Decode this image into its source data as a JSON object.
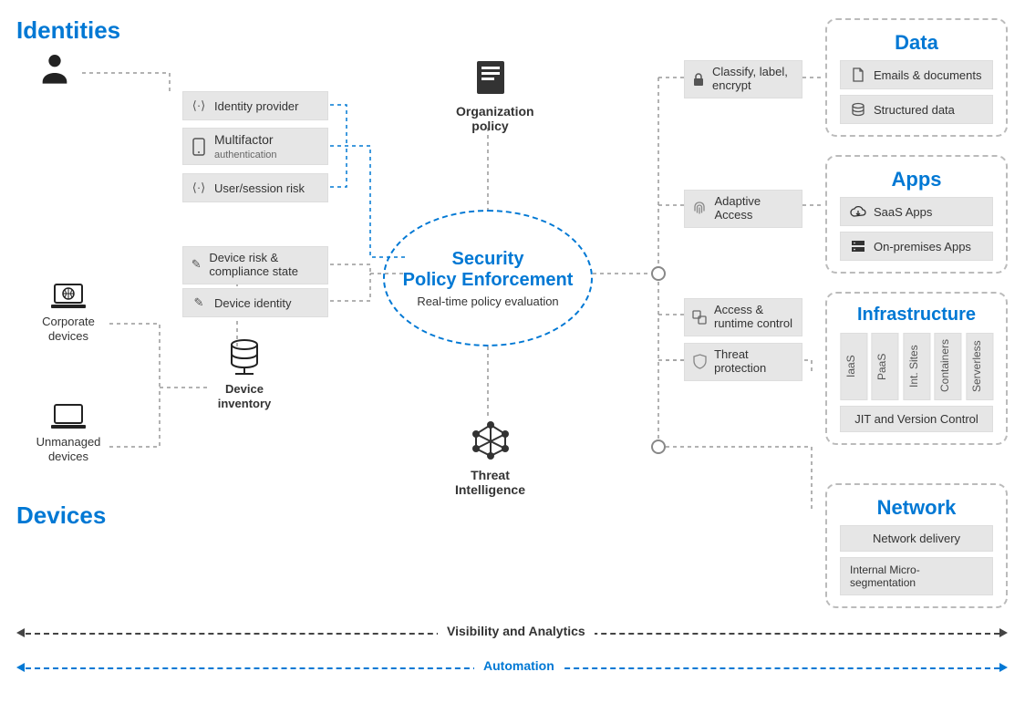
{
  "headings": {
    "identities": "Identities",
    "devices": "Devices"
  },
  "identity_pills": {
    "provider": "Identity  provider",
    "mfa_title": "Multifactor",
    "mfa_sub": "authentication",
    "risk": "User/session risk"
  },
  "device_pills": {
    "risk": "Device  risk & compliance  state",
    "identity": "Device  identity"
  },
  "device_labels": {
    "corporate": "Corporate devices",
    "unmanaged": "Unmanaged devices",
    "inventory": "Device inventory"
  },
  "center": {
    "title1": "Security",
    "title2": "Policy  Enforcement",
    "sub": "Real-time policy evaluation"
  },
  "top_icon": "Organization policy",
  "bottom_icon": "Threat Intelligence",
  "right_pills": {
    "classify": "Classify, label, encrypt",
    "adaptive": "Adaptive Access",
    "access_runtime": "Access & runtime control",
    "threat": "Threat protection"
  },
  "panels": {
    "data": {
      "title": "Data",
      "items": [
        "Emails & documents",
        "Structured data"
      ]
    },
    "apps": {
      "title": "Apps",
      "items": [
        "SaaS Apps",
        "On-premises Apps"
      ]
    },
    "infra": {
      "title": "Infrastructure",
      "cols": [
        "IaaS",
        "PaaS",
        "Int. Sites",
        "Containers",
        "Serverless"
      ],
      "bottom": "JIT and Version Control"
    },
    "network": {
      "title": "Network",
      "items": [
        "Network delivery",
        "Internal Micro-segmentation"
      ]
    }
  },
  "spanners": {
    "visibility": "Visibility and Analytics",
    "automation": "Automation"
  }
}
